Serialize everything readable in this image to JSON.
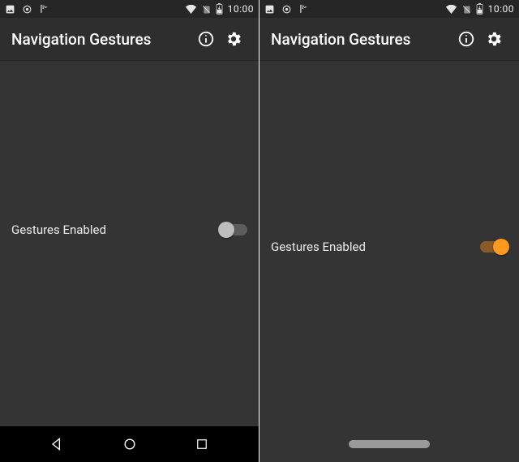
{
  "statusbar": {
    "clock": "10:00"
  },
  "appbar": {
    "title": "Navigation Gestures"
  },
  "left": {
    "gestures_label": "Gestures Enabled",
    "gestures_on": false
  },
  "right": {
    "gestures_label": "Gestures Enabled",
    "gestures_on": true
  }
}
